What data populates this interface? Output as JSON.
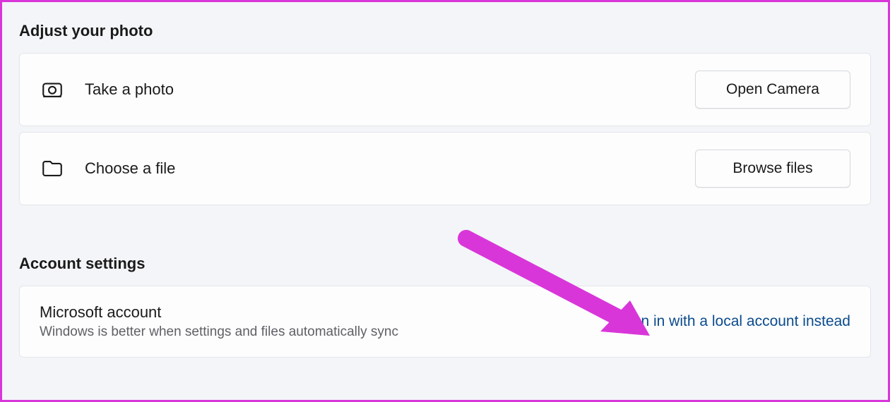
{
  "sections": {
    "photo": {
      "title": "Adjust your photo",
      "take_photo": {
        "label": "Take a photo",
        "button": "Open Camera"
      },
      "choose_file": {
        "label": "Choose a file",
        "button": "Browse files"
      }
    },
    "account": {
      "title": "Account settings",
      "microsoft": {
        "title": "Microsoft account",
        "subtitle": "Windows is better when settings and files automatically sync",
        "link": "Sign in with a local account instead"
      }
    }
  },
  "annotation": {
    "arrow_color": "#d936d9"
  }
}
